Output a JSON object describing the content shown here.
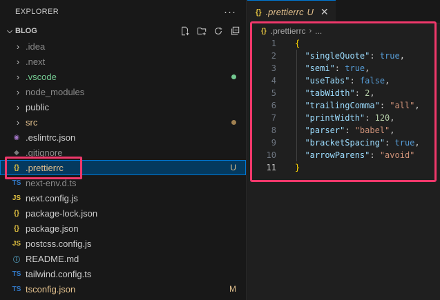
{
  "explorer": {
    "title": "EXPLORER",
    "more_icon": "ellipsis-icon",
    "folder": {
      "name": "BLOG",
      "tools": [
        "new-file-icon",
        "new-folder-icon",
        "refresh-icon",
        "collapse-all-icon"
      ]
    },
    "items": [
      {
        "type": "folder",
        "label": ".idea",
        "color": "#8b8b8b"
      },
      {
        "type": "folder",
        "label": ".next",
        "color": "#8b8b8b"
      },
      {
        "type": "folder",
        "label": ".vscode",
        "color": "#73c991",
        "dot": "#73c991"
      },
      {
        "type": "folder",
        "label": "node_modules",
        "color": "#8b8b8b"
      },
      {
        "type": "folder",
        "label": "public",
        "color": "#cccccc"
      },
      {
        "type": "folder",
        "label": "src",
        "color": "#e2c08d",
        "dot": "#a08050"
      },
      {
        "type": "file",
        "label": ".eslintrc.json",
        "color": "#cccccc",
        "icon": "eslint-icon",
        "glyph": "◉",
        "icolor": "#a074c4"
      },
      {
        "type": "file",
        "label": ".gitignore",
        "color": "#8b8b8b",
        "icon": "git-icon",
        "glyph": "◆",
        "icolor": "#7a7a7a"
      },
      {
        "type": "file",
        "label": ".prettierrc",
        "color": "#e2c08d",
        "icon": "json-braces-icon",
        "glyph": "{}",
        "icolor": "#e0c040",
        "badge": "U",
        "selected": true
      },
      {
        "type": "file",
        "label": "next-env.d.ts",
        "color": "#8b8b8b",
        "icon": "typescript-icon",
        "glyph": "TS",
        "icolor": "#3178c6"
      },
      {
        "type": "file",
        "label": "next.config.js",
        "color": "#cccccc",
        "icon": "javascript-icon",
        "glyph": "JS",
        "icolor": "#e0c040"
      },
      {
        "type": "file",
        "label": "package-lock.json",
        "color": "#cccccc",
        "icon": "json-braces-icon",
        "glyph": "{}",
        "icolor": "#e0c040"
      },
      {
        "type": "file",
        "label": "package.json",
        "color": "#cccccc",
        "icon": "json-braces-icon",
        "glyph": "{}",
        "icolor": "#e0c040"
      },
      {
        "type": "file",
        "label": "postcss.config.js",
        "color": "#cccccc",
        "icon": "javascript-icon",
        "glyph": "JS",
        "icolor": "#e0c040"
      },
      {
        "type": "file",
        "label": "README.md",
        "color": "#cccccc",
        "icon": "info-icon",
        "glyph": "ⓘ",
        "icolor": "#519aba"
      },
      {
        "type": "file",
        "label": "tailwind.config.ts",
        "color": "#cccccc",
        "icon": "typescript-icon",
        "glyph": "TS",
        "icolor": "#3178c6"
      },
      {
        "type": "file",
        "label": "tsconfig.json",
        "color": "#e2c08d",
        "icon": "typescript-icon",
        "glyph": "TS",
        "icolor": "#3178c6",
        "badge": "M"
      }
    ]
  },
  "editor": {
    "tab": {
      "label": ".prettierrc",
      "status": "U",
      "icon": "json-braces-icon"
    },
    "breadcrumb": {
      "file": ".prettierrc",
      "rest": "..."
    },
    "lines": [
      {
        "n": "1",
        "tokens": [
          [
            "br",
            "{"
          ]
        ]
      },
      {
        "n": "2",
        "tokens": [
          [
            "key",
            "  \"singleQuote\""
          ],
          [
            "pun",
            ": "
          ],
          [
            "bool",
            "true"
          ],
          [
            "pun",
            ","
          ]
        ]
      },
      {
        "n": "3",
        "tokens": [
          [
            "key",
            "  \"semi\""
          ],
          [
            "pun",
            ": "
          ],
          [
            "bool",
            "true"
          ],
          [
            "pun",
            ","
          ]
        ]
      },
      {
        "n": "4",
        "tokens": [
          [
            "key",
            "  \"useTabs\""
          ],
          [
            "pun",
            ": "
          ],
          [
            "bool",
            "false"
          ],
          [
            "pun",
            ","
          ]
        ]
      },
      {
        "n": "5",
        "tokens": [
          [
            "key",
            "  \"tabWidth\""
          ],
          [
            "pun",
            ": "
          ],
          [
            "num",
            "2"
          ],
          [
            "pun",
            ","
          ]
        ]
      },
      {
        "n": "6",
        "tokens": [
          [
            "key",
            "  \"trailingComma\""
          ],
          [
            "pun",
            ": "
          ],
          [
            "str",
            "\"all\""
          ],
          [
            "pun",
            ","
          ]
        ]
      },
      {
        "n": "7",
        "tokens": [
          [
            "key",
            "  \"printWidth\""
          ],
          [
            "pun",
            ": "
          ],
          [
            "num",
            "120"
          ],
          [
            "pun",
            ","
          ]
        ]
      },
      {
        "n": "8",
        "tokens": [
          [
            "key",
            "  \"parser\""
          ],
          [
            "pun",
            ": "
          ],
          [
            "str",
            "\"babel\""
          ],
          [
            "pun",
            ","
          ]
        ]
      },
      {
        "n": "9",
        "tokens": [
          [
            "key",
            "  \"bracketSpacing\""
          ],
          [
            "pun",
            ": "
          ],
          [
            "bool",
            "true"
          ],
          [
            "pun",
            ","
          ]
        ]
      },
      {
        "n": "10",
        "tokens": [
          [
            "key",
            "  \"arrowParens\""
          ],
          [
            "pun",
            ": "
          ],
          [
            "str",
            "\"avoid\""
          ]
        ]
      },
      {
        "n": "11",
        "tokens": [
          [
            "br",
            "}"
          ]
        ],
        "current": true
      }
    ]
  },
  "colors": {
    "highlight": "#f0386b",
    "accent": "#0078d4"
  }
}
